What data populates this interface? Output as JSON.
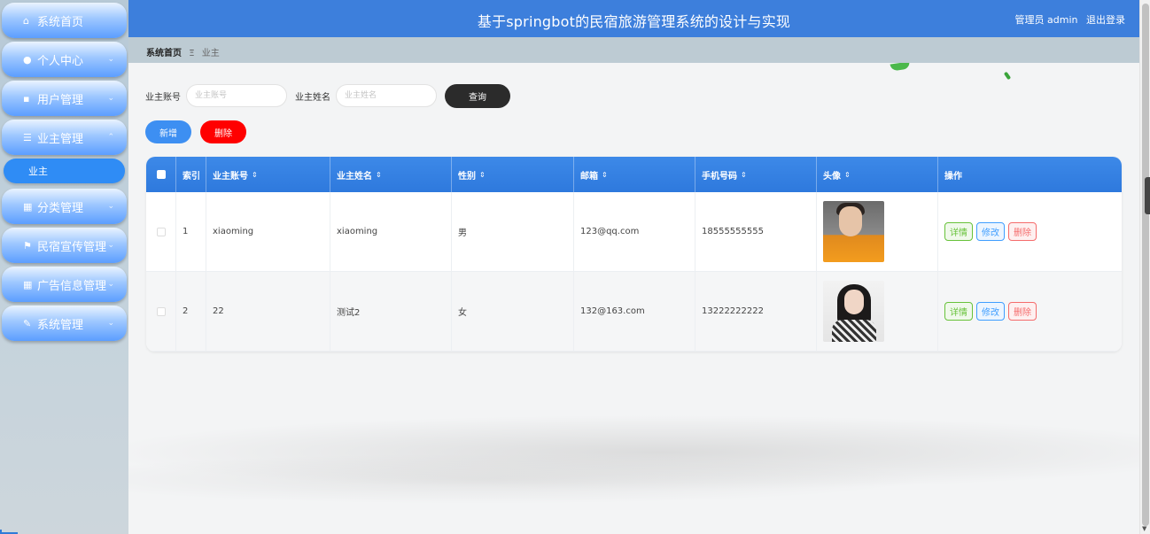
{
  "app": {
    "title": "基于springbot的民宿旅游管理系统的设计与实现",
    "user_label": "管理员 admin",
    "logout_label": "退出登录"
  },
  "sidebar": {
    "items": [
      {
        "label": "系统首页",
        "icon": "home-icon",
        "chevron": ""
      },
      {
        "label": "个人中心",
        "icon": "user-icon",
        "chevron": "⌄"
      },
      {
        "label": "用户管理",
        "icon": "card-icon",
        "chevron": "⌄"
      },
      {
        "label": "业主管理",
        "icon": "list-icon",
        "chevron": "⌃"
      },
      {
        "label": "分类管理",
        "icon": "grid-icon",
        "chevron": "⌄"
      },
      {
        "label": "民宿宣传管理",
        "icon": "flag-icon",
        "chevron": "⌄"
      },
      {
        "label": "广告信息管理",
        "icon": "grid-icon",
        "chevron": "⌄"
      },
      {
        "label": "系统管理",
        "icon": "thumb-icon",
        "chevron": "⌄"
      }
    ],
    "active_sub": "业主"
  },
  "breadcrumb": {
    "home": "系统首页",
    "separator": "Ξ",
    "current": "业主"
  },
  "search": {
    "account_label": "业主账号",
    "account_placeholder": "业主账号",
    "name_label": "业主姓名",
    "name_placeholder": "业主姓名",
    "query_button": "查询"
  },
  "actions": {
    "add_button": "新增",
    "delete_button": "删除"
  },
  "table": {
    "columns": [
      "索引",
      "业主账号",
      "业主姓名",
      "性别",
      "邮箱",
      "手机号码",
      "头像",
      "操作"
    ],
    "sort_glyph": "⇕",
    "rows": [
      {
        "index": "1",
        "account": "xiaoming",
        "name": "xiaoming",
        "gender": "男",
        "email": "123@qq.com",
        "phone": "18555555555"
      },
      {
        "index": "2",
        "account": "22",
        "name": "测试2",
        "gender": "女",
        "email": "132@163.com",
        "phone": "13222222222"
      }
    ],
    "op_detail": "详情",
    "op_edit": "修改",
    "op_delete": "删除"
  },
  "colors": {
    "header_bg": "#3d7fdc",
    "table_header": "#2e79dd",
    "query_button": "#2b2b2b",
    "add_button": "#3d8ff2",
    "delete_button": "#ff0000"
  }
}
